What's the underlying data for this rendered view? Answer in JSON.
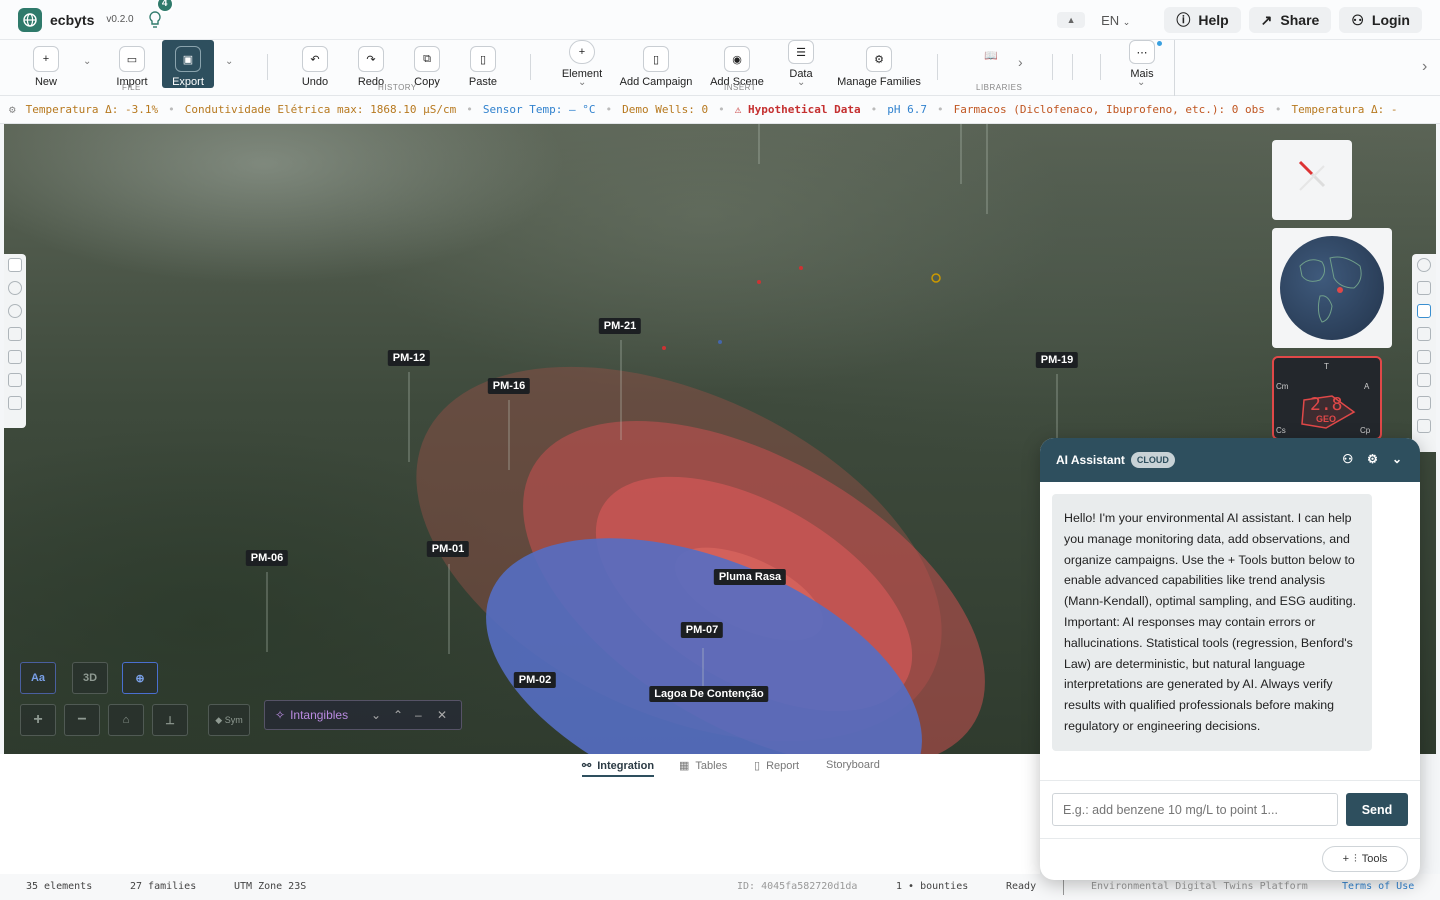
{
  "app": {
    "name": "ecbyts",
    "version": "v0.2.0",
    "notifications": "4"
  },
  "topbar": {
    "lang": "EN",
    "help": "Help",
    "share": "Share",
    "login": "Login"
  },
  "ribbon": {
    "new": "New",
    "import": "Import",
    "export": "Export",
    "file_group": "FILE",
    "undo": "Undo",
    "redo": "Redo",
    "copy": "Copy",
    "paste": "Paste",
    "history_group": "HISTORY",
    "element": "Element",
    "add_campaign": "Add Campaign",
    "add_scene": "Add Scene",
    "data": "Data",
    "manage_families": "Manage Families",
    "insert_group": "INSERT",
    "libraries_group": "LIBRARIES",
    "more": "Mais"
  },
  "ticker": [
    {
      "text": "Temperatura Δ: -3.1%",
      "color": "#b7791f"
    },
    {
      "text": "Condutividade Elétrica max: 1868.10 µS/cm",
      "color": "#b7791f"
    },
    {
      "text": "Sensor Temp: — °C",
      "color": "#3182ce"
    },
    {
      "text": "Demo Wells: 0",
      "color": "#b7791f"
    },
    {
      "text": "⚠ Hypothetical Data",
      "color": "#c53030"
    },
    {
      "text": "pH 6.7",
      "color": "#3182ce"
    },
    {
      "text": "Farmacos (Diclofenaco, Ibuprofeno, etc.): 0 obs",
      "color": "#c05621"
    },
    {
      "text": "Temperatura Δ: -",
      "color": "#b7791f"
    }
  ],
  "wells": [
    "PM-12",
    "PM-21",
    "PM-16",
    "PM-19",
    "PM-06",
    "PM-01",
    "Pluma Rasa",
    "PM-07",
    "PM-02",
    "Lagoa De Contenção"
  ],
  "geo_widget": {
    "value": "2.8",
    "label": "GEO",
    "t": "T",
    "a": "A",
    "cm": "Cm",
    "cs": "Cs",
    "cp": "Cp"
  },
  "map_controls": {
    "aa": "Aa",
    "three_d": "3D",
    "sym": "Sym",
    "intangibles": "Intangibles"
  },
  "bottom_tabs": [
    "Integration",
    "Tables",
    "Report",
    "Storyboard"
  ],
  "status": {
    "elements": "35 elements",
    "families": "27 families",
    "zone": "UTM Zone 23S",
    "id": "ID: 4045fa582720d1da",
    "bounties": "1 • bounties",
    "ready": "Ready",
    "platform": "Environmental Digital Twins Platform",
    "terms": "Terms of Use"
  },
  "ai": {
    "title": "AI Assistant",
    "badge": "CLOUD",
    "message": "Hello! I'm your environmental AI assistant. I can help you manage monitoring data, add observations, and organize campaigns. Use the + Tools button below to enable advanced capabilities like trend analysis (Mann-Kendall), optimal sampling, and ESG auditing. Important: AI responses may contain errors or hallucinations. Statistical tools (regression, Benford's Law) are deterministic, but natural language interpretations are generated by AI. Always verify results with qualified professionals before making regulatory or engineering decisions.",
    "placeholder": "E.g.: add benzene 10 mg/L to point 1...",
    "send": "Send",
    "tools": "Tools"
  }
}
